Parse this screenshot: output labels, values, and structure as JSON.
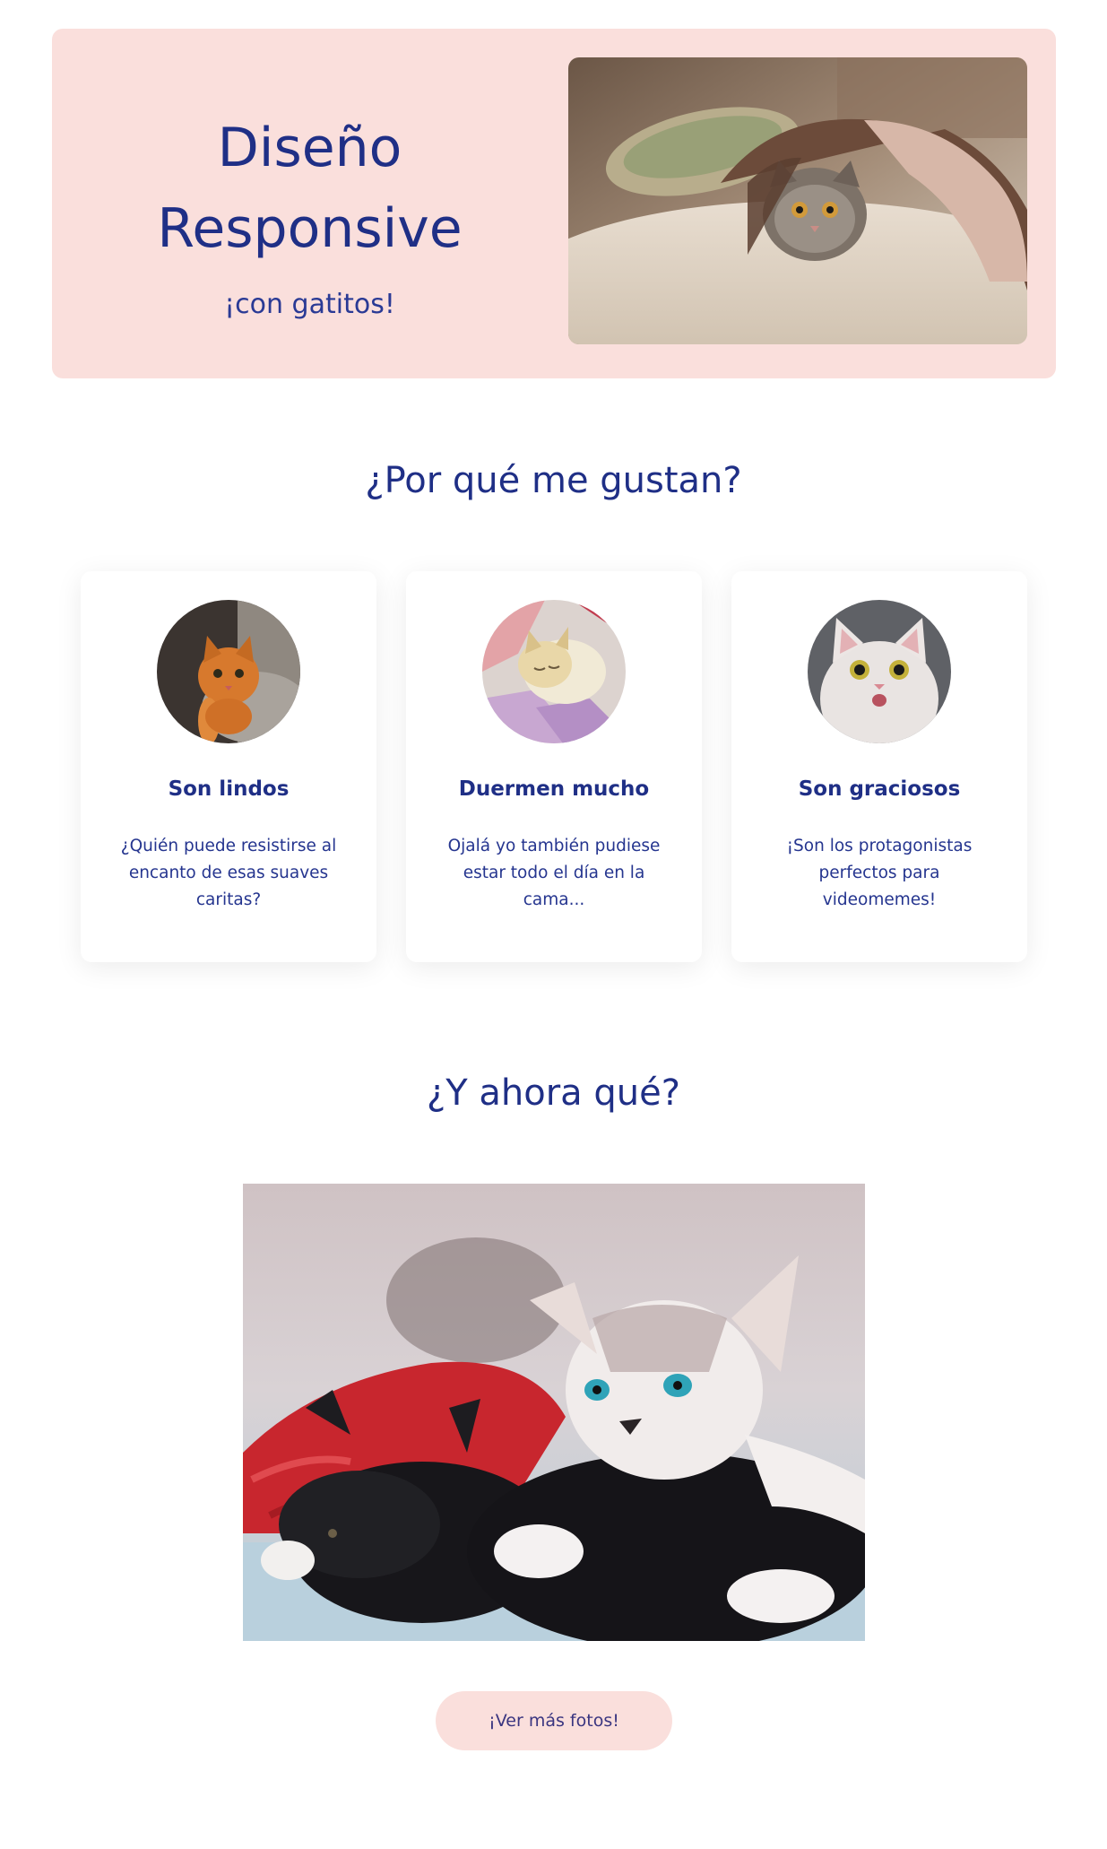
{
  "hero": {
    "title_line1": "Diseño",
    "title_line2": "Responsive",
    "subtitle": "¡con gatitos!",
    "image_icon": "cat-under-blanket-photo"
  },
  "why": {
    "title": "¿Por qué me gustan?",
    "cards": [
      {
        "title": "Son lindos",
        "text": "¿Quién puede resistirse al encanto de esas suaves caritas?",
        "image_icon": "orange-cat-photo"
      },
      {
        "title": "Duermen mucho",
        "text": "Ojalá yo también pudiese estar todo el día en la cama...",
        "image_icon": "sleeping-cat-photo"
      },
      {
        "title": "Son graciosos",
        "text": "¡Son los protagonistas perfectos para videomemes!",
        "image_icon": "surprised-cat-photo"
      }
    ]
  },
  "now": {
    "title": "¿Y ahora qué?",
    "image_icon": "two-kittens-photo",
    "button_label": "¡Ver más fotos!"
  },
  "colors": {
    "accent_pink": "#fadfdc",
    "text_navy": "#1f2f86"
  }
}
